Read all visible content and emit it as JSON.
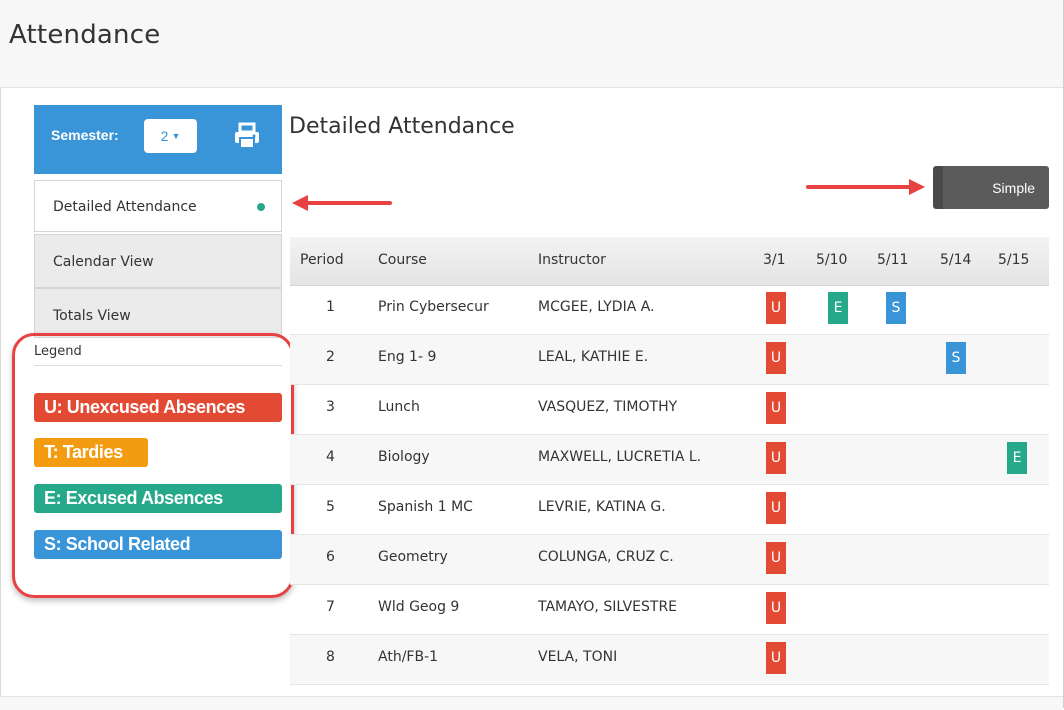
{
  "page": {
    "title": "Attendance"
  },
  "sidebar": {
    "semester_label": "Semester:",
    "semester_value": "2",
    "print_icon": "print-icon",
    "nav": [
      {
        "label": "Detailed Attendance",
        "active": true
      },
      {
        "label": "Calendar View",
        "active": false
      },
      {
        "label": "Totals View",
        "active": false
      }
    ],
    "legend_title": "Legend",
    "legend": [
      {
        "label": "U: Unexcused Absences",
        "color": "#e34a33"
      },
      {
        "label": "T: Tardies",
        "color": "#f39c12"
      },
      {
        "label": "E: Excused Absences",
        "color": "#26a98a"
      },
      {
        "label": "S: School Related",
        "color": "#3a95d8"
      }
    ]
  },
  "main": {
    "title": "Detailed Attendance",
    "toggle_label": "Simple",
    "columns": [
      "Period",
      "Course",
      "Instructor",
      "3/1",
      "5/10",
      "5/11",
      "5/14",
      "5/15"
    ],
    "rows": [
      {
        "period": "1",
        "course": "Prin Cybersecur",
        "instructor": "MCGEE, LYDIA A.",
        "marks": {
          "3/1": "U",
          "5/10": "E",
          "5/11": "S"
        }
      },
      {
        "period": "2",
        "course": "Eng 1- 9",
        "instructor": "LEAL, KATHIE E.",
        "marks": {
          "3/1": "U",
          "5/14": "S"
        }
      },
      {
        "period": "3",
        "course": "Lunch",
        "instructor": "VASQUEZ, TIMOTHY",
        "marks": {
          "3/1": "U"
        }
      },
      {
        "period": "4",
        "course": "Biology",
        "instructor": "MAXWELL, LUCRETIA L.",
        "marks": {
          "3/1": "U",
          "5/15": "E"
        }
      },
      {
        "period": "5",
        "course": "Spanish 1 MC",
        "instructor": "LEVRIE, KATINA G.",
        "marks": {
          "3/1": "U"
        }
      },
      {
        "period": "6",
        "course": "Geometry",
        "instructor": "COLUNGA, CRUZ C.",
        "marks": {
          "3/1": "U"
        }
      },
      {
        "period": "7",
        "course": "Wld Geog 9",
        "instructor": "TAMAYO, SILVESTRE",
        "marks": {
          "3/1": "U"
        }
      },
      {
        "period": "8",
        "course": "Ath/FB-1",
        "instructor": "VELA, TONI",
        "marks": {
          "3/1": "U"
        }
      }
    ]
  },
  "colors": {
    "U": "#e34a33",
    "T": "#f39c12",
    "E": "#26a98a",
    "S": "#3a95d8",
    "annotation": "#e84141"
  }
}
